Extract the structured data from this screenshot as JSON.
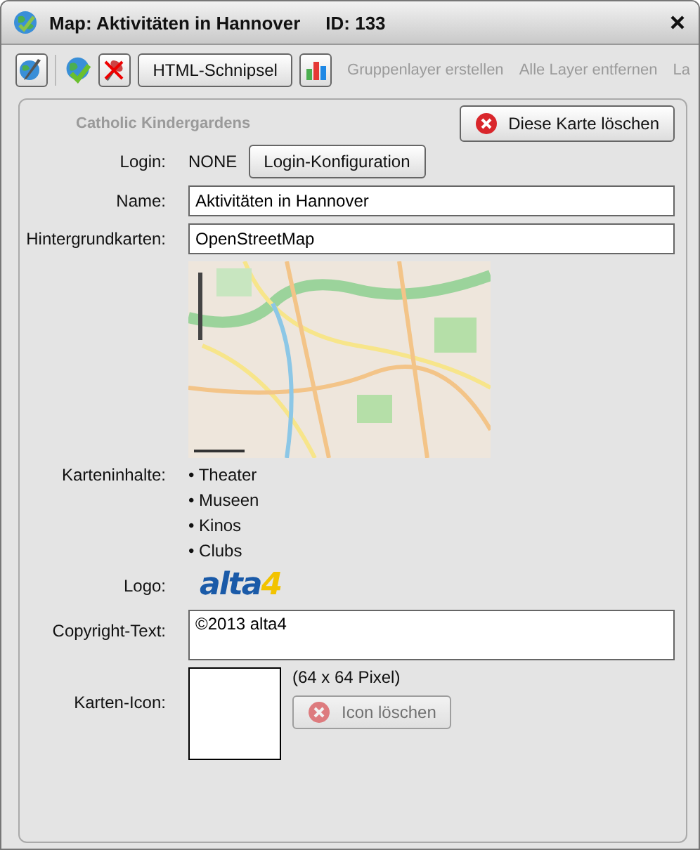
{
  "window": {
    "title": "Map:  Aktivitäten in Hannover",
    "id_label": "ID:  133"
  },
  "toolbar": {
    "html_button": "HTML-Schnipsel"
  },
  "background": {
    "toolbar_items": [
      "Gruppenlayer erstellen",
      "Alle Layer entfernen",
      "La"
    ],
    "layer_name": "Catholic Kindergardens"
  },
  "delete_map_button": "Diese Karte löschen",
  "form": {
    "login_label": "Login:",
    "login_value": "NONE",
    "login_button": "Login-Konfiguration",
    "name_label": "Name:",
    "name_value": "Aktivitäten in Hannover",
    "basemap_label": "Hintergrundkarten:",
    "basemap_value": "OpenStreetMap",
    "contents_label": "Karteninhalte:",
    "contents": [
      "• Theater",
      "• Museen",
      "• Kinos",
      "• Clubs"
    ],
    "logo_label": "Logo:",
    "logo_text": "alta4",
    "copyright_label": "Copyright-Text:",
    "copyright_value": "©2013 alta4",
    "icon_label": "Karten-Icon:",
    "icon_size": "(64 x 64 Pixel)",
    "icon_delete": {
      "label": "Icon löschen",
      "disabled": true
    }
  }
}
